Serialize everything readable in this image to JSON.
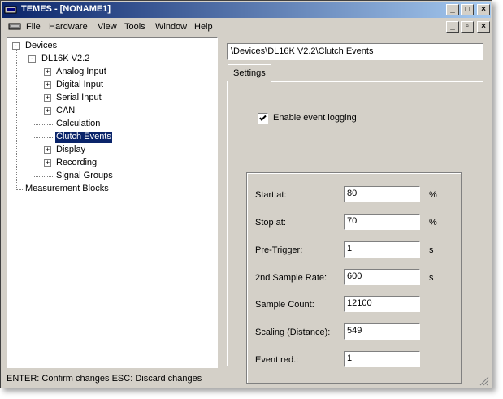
{
  "window": {
    "title": "TEMES - [NONAME1]",
    "controls": {
      "minimize": "_",
      "maximize": "□",
      "close": "×"
    },
    "mdi_controls": {
      "minimize": "_",
      "restore": "▫",
      "close": "×"
    }
  },
  "menubar": {
    "items": [
      {
        "label": "File"
      },
      {
        "label": "Hardware"
      },
      {
        "label": "View"
      },
      {
        "label": "Tools"
      },
      {
        "label": "Window"
      },
      {
        "label": "Help"
      }
    ]
  },
  "tree": {
    "nodes": [
      {
        "label": "Devices",
        "expander": "-"
      },
      {
        "label": "DL16K V2.2",
        "expander": "-"
      },
      {
        "label": "Analog Input",
        "expander": "+"
      },
      {
        "label": "Digital Input",
        "expander": "+"
      },
      {
        "label": "Serial Input",
        "expander": "+"
      },
      {
        "label": "CAN",
        "expander": "+"
      },
      {
        "label": "Calculation",
        "expander": ""
      },
      {
        "label": "Clutch Events",
        "expander": "",
        "selected": true
      },
      {
        "label": "Display",
        "expander": "+"
      },
      {
        "label": "Recording",
        "expander": "+"
      },
      {
        "label": "Signal Groups",
        "expander": ""
      },
      {
        "label": "Measurement Blocks",
        "expander": ""
      }
    ]
  },
  "path": "\\Devices\\DL16K V2.2\\Clutch Events",
  "tabs": [
    {
      "label": "Settings",
      "active": true
    }
  ],
  "settings": {
    "enable_logging": {
      "label": "Enable event logging",
      "checked": true
    },
    "fields": [
      {
        "label": "Start at:",
        "value": "80",
        "unit": "%"
      },
      {
        "label": "Stop at:",
        "value": "70",
        "unit": "%"
      },
      {
        "label": "Pre-Trigger:",
        "value": "1",
        "unit": "s"
      },
      {
        "label": "2nd Sample Rate:",
        "value": "600",
        "unit": "s"
      },
      {
        "label": "Sample Count:",
        "value": "12100",
        "unit": ""
      },
      {
        "label": "Scaling (Distance):",
        "value": "549",
        "unit": ""
      },
      {
        "label": "Event red.:",
        "value": "1",
        "unit": ""
      }
    ]
  },
  "statusbar": {
    "text": "ENTER: Confirm changes   ESC: Discard changes"
  },
  "colors": {
    "titlebar_start": "#0a246a",
    "titlebar_end": "#a6caf0",
    "face": "#d4d0c8",
    "selection": "#0a246a"
  }
}
